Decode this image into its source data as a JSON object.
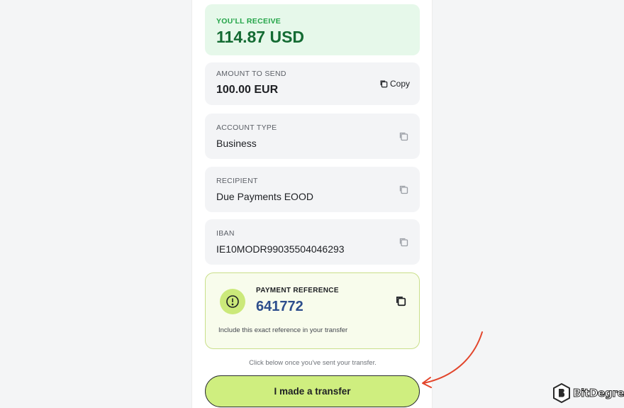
{
  "receive": {
    "label": "YOU'LL RECEIVE",
    "amount": "114.87 USD"
  },
  "send": {
    "label": "AMOUNT TO SEND",
    "amount": "100.00 EUR",
    "copy_label": "Copy",
    "copy_icon": "copy-icon"
  },
  "account_type": {
    "label": "ACCOUNT TYPE",
    "value": "Business"
  },
  "recipient": {
    "label": "RECIPIENT",
    "value": "Due Payments EOOD"
  },
  "iban": {
    "label": "IBAN",
    "value": "IE10MODR99035504046293"
  },
  "payment_reference": {
    "label": "PAYMENT REFERENCE",
    "value": "641772",
    "note": "Include this exact reference in your transfer",
    "icon": "alert-circle-icon"
  },
  "hint": "Click below once you've sent your transfer.",
  "cta_label": "I made a transfer",
  "brand": {
    "name": "BitDegree"
  },
  "colors": {
    "accent_green": "#cfee7f",
    "receive_green": "#146b33",
    "reference_blue": "#2d4e8c",
    "arrow_red": "#e2452b"
  }
}
